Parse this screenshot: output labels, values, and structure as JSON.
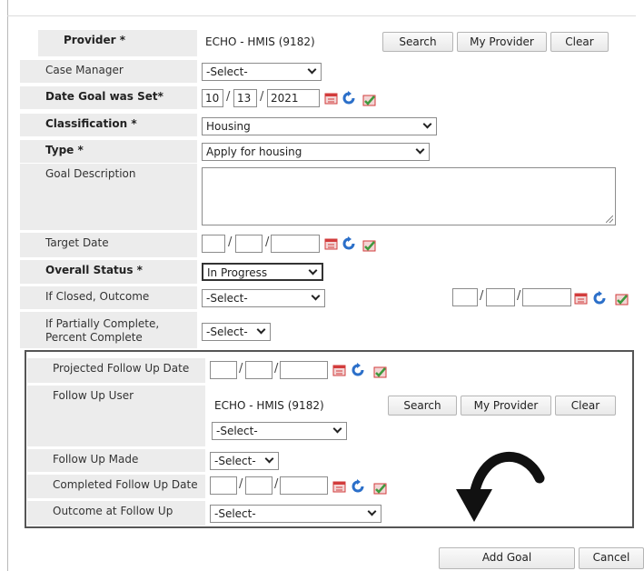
{
  "provider": {
    "label": "Provider",
    "value": "ECHO - HMIS (9182)",
    "search": "Search",
    "my_provider": "My Provider",
    "clear": "Clear"
  },
  "case_manager": {
    "label": "Case Manager",
    "value": "-Select-"
  },
  "date_goal_set": {
    "label": "Date Goal was Set",
    "month": "10",
    "day": "13",
    "year": "2021"
  },
  "classification": {
    "label": "Classification",
    "value": "Housing"
  },
  "type": {
    "label": "Type",
    "value": "Apply for housing"
  },
  "goal_description": {
    "label": "Goal Description",
    "value": ""
  },
  "target_date": {
    "label": "Target Date"
  },
  "overall_status": {
    "label": "Overall Status",
    "value": "In Progress"
  },
  "closed_outcome": {
    "label": "If Closed, Outcome",
    "value": "-Select-"
  },
  "partial_percent": {
    "label": "If Partially Complete, Percent Complete",
    "value": "-Select-"
  },
  "followup": {
    "projected_label": "Projected Follow Up Date",
    "user_label": "Follow Up User",
    "user_value": "ECHO - HMIS (9182)",
    "search": "Search",
    "my_provider": "My Provider",
    "clear": "Clear",
    "user_select": "-Select-",
    "made_label": "Follow Up Made",
    "made_value": "-Select-",
    "completed_label": "Completed Follow Up Date",
    "outcome_label": "Outcome at Follow Up",
    "outcome_value": "-Select-"
  },
  "footer": {
    "add_goal": "Add Goal",
    "cancel": "Cancel"
  },
  "required_marker": "*",
  "icons": {
    "calendar": "calendar-icon",
    "refresh": "refresh-icon",
    "today": "today-icon",
    "arrow": "curved-arrow-icon"
  },
  "colors": {
    "label_bg": "#ececec",
    "calendar_red": "#d23c3c",
    "refresh_blue": "#2b6fc9",
    "today_green": "#3e9a3e"
  }
}
